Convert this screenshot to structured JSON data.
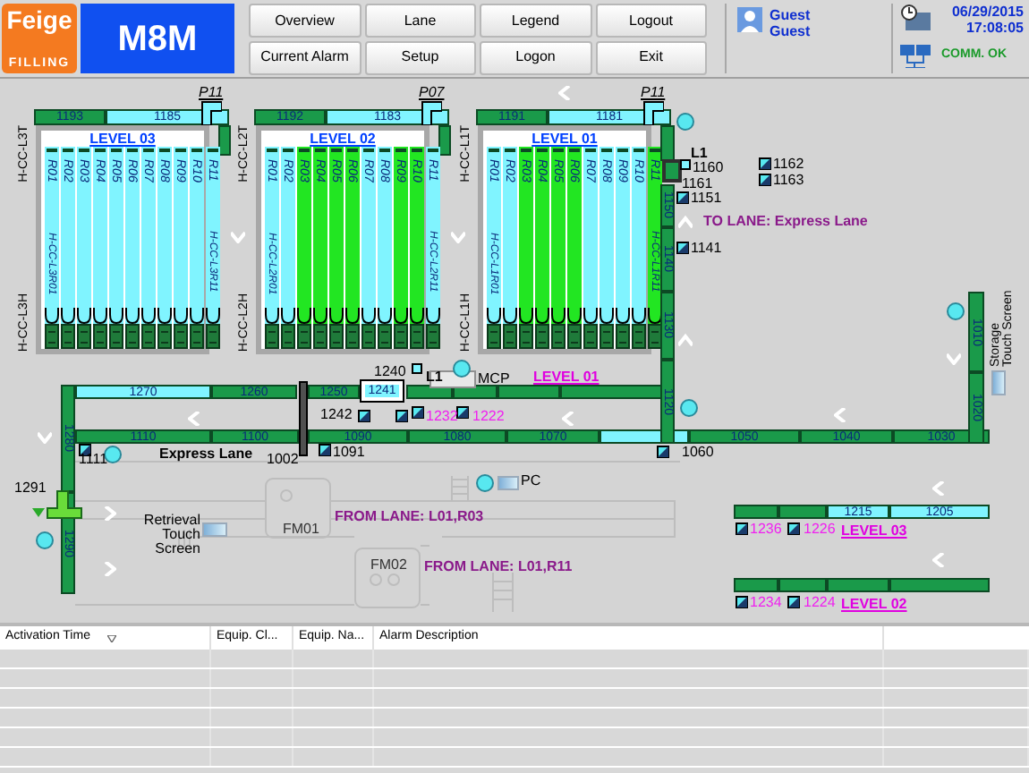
{
  "header": {
    "brand": "Feige",
    "brand_sub": "FILLING",
    "title": "M8M",
    "user_name": "Guest",
    "user_role": "Guest",
    "date": "06/29/2015",
    "time": "17:08:05",
    "comm_status": "COMM. OK"
  },
  "nav_buttons": [
    "Overview",
    "Lane",
    "Legend",
    "Logout",
    "Current Alarm",
    "Setup",
    "Logon",
    "Exit"
  ],
  "racks": [
    {
      "level_label": "LEVEL 03",
      "pillar_label": "P11",
      "side_top_label": "H-CC-L3T",
      "side_bottom_label": "H-CC-L3H",
      "first_lane_code": "H-CC-L3R01",
      "last_lane_code": "H-CC-L3R11",
      "top_segments": [
        {
          "label": "1193",
          "color": "#1a9a4a"
        },
        {
          "label": "1185",
          "color": "#80f4ff"
        }
      ],
      "lanes": [
        {
          "label": "R01",
          "color": "#80f4ff"
        },
        {
          "label": "R02",
          "color": "#80f4ff"
        },
        {
          "label": "R03",
          "color": "#80f4ff"
        },
        {
          "label": "R04",
          "color": "#80f4ff"
        },
        {
          "label": "R05",
          "color": "#80f4ff"
        },
        {
          "label": "R06",
          "color": "#80f4ff"
        },
        {
          "label": "R07",
          "color": "#80f4ff"
        },
        {
          "label": "R08",
          "color": "#80f4ff"
        },
        {
          "label": "R09",
          "color": "#80f4ff"
        },
        {
          "label": "R10",
          "color": "#80f4ff"
        },
        {
          "label": "R11",
          "color": "#80f4ff"
        }
      ]
    },
    {
      "level_label": "LEVEL 02",
      "pillar_label": "P07",
      "side_top_label": "H-CC-L2T",
      "side_bottom_label": "H-CC-L2H",
      "first_lane_code": "H-CC-L2R01",
      "last_lane_code": "H-CC-L2R11",
      "top_segments": [
        {
          "label": "1192",
          "color": "#1a9a4a"
        },
        {
          "label": "1183",
          "color": "#80f4ff"
        }
      ],
      "lanes": [
        {
          "label": "R01",
          "color": "#80f4ff"
        },
        {
          "label": "R02",
          "color": "#80f4ff"
        },
        {
          "label": "R03",
          "color": "#22e622"
        },
        {
          "label": "R04",
          "color": "#22e622"
        },
        {
          "label": "R05",
          "color": "#22e622"
        },
        {
          "label": "R06",
          "color": "#22e622"
        },
        {
          "label": "R07",
          "color": "#80f4ff"
        },
        {
          "label": "R08",
          "color": "#80f4ff"
        },
        {
          "label": "R09",
          "color": "#22e622"
        },
        {
          "label": "R10",
          "color": "#22e622"
        },
        {
          "label": "R11",
          "color": "#80f4ff"
        }
      ]
    },
    {
      "level_label": "LEVEL 01",
      "pillar_label": "P11",
      "side_top_label": "H-CC-L1T",
      "side_bottom_label": "H-CC-L1H",
      "first_lane_code": "H-CC-L1R01",
      "last_lane_code": "H-CC-L1R11",
      "top_segments": [
        {
          "label": "1191",
          "color": "#1a9a4a"
        },
        {
          "label": "1181",
          "color": "#80f4ff"
        }
      ],
      "lanes": [
        {
          "label": "R01",
          "color": "#80f4ff"
        },
        {
          "label": "R02",
          "color": "#80f4ff"
        },
        {
          "label": "R03",
          "color": "#22e622"
        },
        {
          "label": "R04",
          "color": "#22e622"
        },
        {
          "label": "R05",
          "color": "#22e622"
        },
        {
          "label": "R06",
          "color": "#22e622"
        },
        {
          "label": "R07",
          "color": "#80f4ff"
        },
        {
          "label": "R08",
          "color": "#80f4ff"
        },
        {
          "label": "R09",
          "color": "#80f4ff"
        },
        {
          "label": "R10",
          "color": "#80f4ff"
        },
        {
          "label": "R11",
          "color": "#22e622"
        }
      ]
    }
  ],
  "conveyor_segments": [
    {
      "label": "1270",
      "color": "#80f4ff"
    },
    {
      "label": "1260",
      "color": "#1a9a4a"
    },
    {
      "label": "1250",
      "color": "#1a9a4a"
    },
    {
      "label": "1241",
      "color": "#80f4ff"
    },
    {
      "color": "#1a9a4a"
    },
    {
      "color": "#1a9a4a"
    },
    {
      "color": "#1a9a4a"
    },
    {
      "color": "#1a9a4a"
    },
    {
      "label": "1110",
      "color": "#1a9a4a"
    },
    {
      "label": "1100",
      "color": "#1a9a4a"
    },
    {
      "label": "1090",
      "color": "#1a9a4a"
    },
    {
      "label": "1080",
      "color": "#1a9a4a"
    },
    {
      "label": "1070",
      "color": "#1a9a4a"
    },
    {
      "color": "#80f4ff"
    },
    {
      "label": "1050",
      "color": "#1a9a4a"
    },
    {
      "label": "1040",
      "color": "#1a9a4a"
    },
    {
      "label": "1030",
      "color": "#1a9a4a"
    },
    {
      "label": "1280",
      "color": "#1a9a4a"
    },
    {
      "label": "1290",
      "color": "#1a9a4a"
    },
    {
      "color": "#1a9a4a"
    },
    {
      "label": "1150",
      "color": "#1a9a4a"
    },
    {
      "label": "1140",
      "color": "#1a9a4a"
    },
    {
      "label": "1130",
      "color": "#1a9a4a"
    },
    {
      "label": "1120",
      "color": "#1a9a4a"
    },
    {
      "label": "1010",
      "color": "#1a9a4a"
    },
    {
      "label": "1020",
      "color": "#1a9a4a"
    },
    {
      "color": "#1a9a4a"
    },
    {
      "color": "#1a9a4a"
    },
    {
      "label": "1215",
      "color": "#80f4ff"
    },
    {
      "label": "1205",
      "color": "#80f4ff"
    },
    {
      "color": "#1a9a4a"
    },
    {
      "color": "#1a9a4a"
    },
    {
      "color": "#1a9a4a"
    },
    {
      "color": "#1a9a4a"
    }
  ],
  "labels": [
    {
      "text": "1240",
      "kind": "id"
    },
    {
      "text": "L1",
      "kind": "tag"
    },
    {
      "text": "MCP",
      "kind": "id"
    },
    {
      "text": "LEVEL 01",
      "kind": "level"
    },
    {
      "text": "1242",
      "kind": "id"
    },
    {
      "text": "1232",
      "kind": "dest"
    },
    {
      "text": "1222",
      "kind": "dest"
    },
    {
      "text": "1111",
      "kind": "id"
    },
    {
      "text": "Express Lane",
      "kind": "tag"
    },
    {
      "text": "1002",
      "kind": "id"
    },
    {
      "text": "1091",
      "kind": "id"
    },
    {
      "text": "1060",
      "kind": "id"
    },
    {
      "text": "1291",
      "kind": "id"
    },
    {
      "text": "L1",
      "kind": "tag"
    },
    {
      "text": "1160",
      "kind": "id"
    },
    {
      "text": "1161",
      "kind": "id"
    },
    {
      "text": "1162",
      "kind": "id"
    },
    {
      "text": "1163",
      "kind": "id"
    },
    {
      "text": "1151",
      "kind": "id"
    },
    {
      "text": "TO LANE: Express Lane",
      "kind": "route"
    },
    {
      "text": "1141",
      "kind": "id"
    },
    {
      "text": "PC",
      "kind": "id"
    },
    {
      "text": "Retrieval Touch Screen",
      "kind": "screen"
    },
    {
      "text": "Storage Touch Screen",
      "kind": "vscreen"
    },
    {
      "text": "FM01",
      "kind": "device"
    },
    {
      "text": "FROM LANE: L01,R03",
      "kind": "route"
    },
    {
      "text": "FM02",
      "kind": "device"
    },
    {
      "text": "FROM LANE: L01,R11",
      "kind": "route"
    },
    {
      "text": "1236",
      "kind": "dest"
    },
    {
      "text": "1226",
      "kind": "dest"
    },
    {
      "text": "LEVEL 03",
      "kind": "level"
    },
    {
      "text": "1234",
      "kind": "dest"
    },
    {
      "text": "1224",
      "kind": "dest"
    },
    {
      "text": "LEVEL 02",
      "kind": "level"
    }
  ],
  "alarm_table": {
    "columns": [
      "Activation Time",
      "Equip. Cl...",
      "Equip. Na...",
      "Alarm Description"
    ]
  }
}
